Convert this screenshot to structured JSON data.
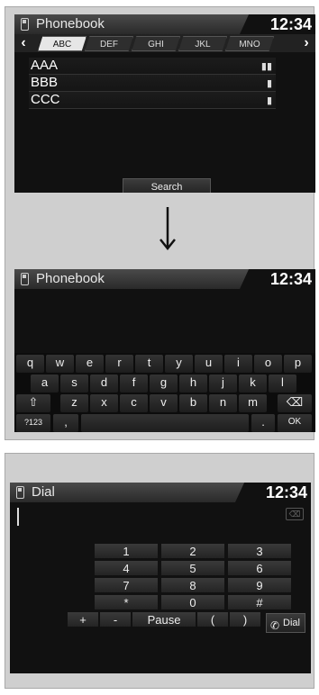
{
  "panel1": {
    "title": "Phonebook",
    "clock": "12:34",
    "tabs": [
      "ABC",
      "DEF",
      "GHI",
      "JKL",
      "MNO"
    ],
    "active_tab": "ABC",
    "contacts": [
      {
        "name": "AAA",
        "icon": "multi-phone-icon"
      },
      {
        "name": "BBB",
        "icon": "phone-icon"
      },
      {
        "name": "CCC",
        "icon": "phone-icon"
      }
    ],
    "search_label": "Search"
  },
  "panel2": {
    "title": "Phonebook",
    "clock": "12:34",
    "keyboard": {
      "row1": [
        "q",
        "w",
        "e",
        "r",
        "t",
        "y",
        "u",
        "i",
        "o",
        "p"
      ],
      "row2": [
        "a",
        "s",
        "d",
        "f",
        "g",
        "h",
        "j",
        "k",
        "l"
      ],
      "row3": [
        "z",
        "x",
        "c",
        "v",
        "b",
        "n",
        "m"
      ],
      "shift_icon": "⇧",
      "backspace_icon": "⌫",
      "mode_label": "?123",
      "comma": ",",
      "period": ".",
      "ok_label": "OK"
    }
  },
  "panel3": {
    "title": "Dial",
    "clock": "12:34",
    "keys": [
      [
        "1",
        "2",
        "3"
      ],
      [
        "4",
        "5",
        "6"
      ],
      [
        "7",
        "8",
        "9"
      ],
      [
        "*",
        "0",
        "#"
      ]
    ],
    "bottom_row": [
      "+",
      "-",
      "Pause",
      "(",
      ")"
    ],
    "dial_label": "Dial"
  }
}
